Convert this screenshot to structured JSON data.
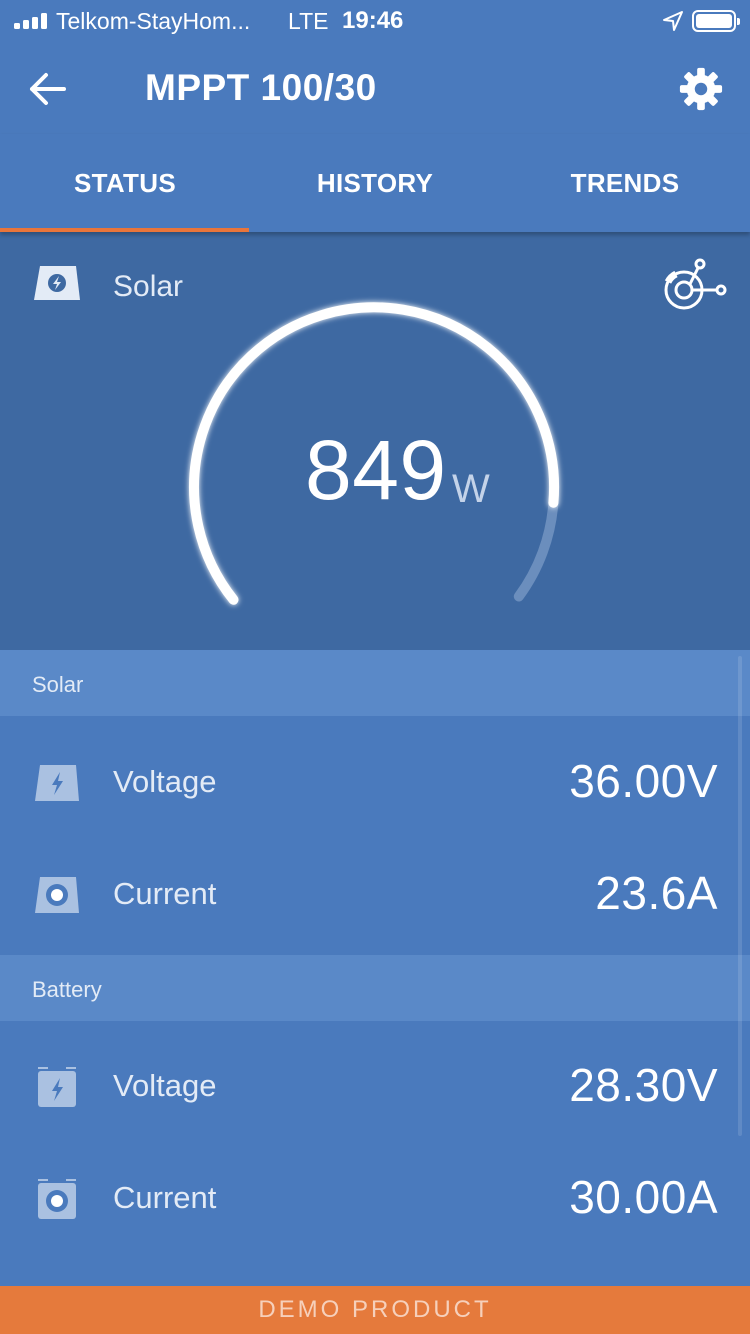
{
  "status_bar": {
    "carrier": "Telkom-StayHom...",
    "network": "LTE",
    "time": "19:46",
    "icons": [
      "signal-icon",
      "location-arrow-icon",
      "battery-icon"
    ]
  },
  "header": {
    "title": "MPPT 100/30",
    "back_icon": "arrow-left-icon",
    "settings_icon": "gear-icon"
  },
  "tabs": [
    {
      "label": "STATUS",
      "active": true
    },
    {
      "label": "HISTORY",
      "active": false
    },
    {
      "label": "TRENDS",
      "active": false
    }
  ],
  "gauge": {
    "label": "Solar",
    "value": "849",
    "unit": "W",
    "icon": "solar-panel-icon",
    "connect_icon": "network-connect-icon"
  },
  "sections": [
    {
      "title": "Solar",
      "rows": [
        {
          "label": "Voltage",
          "value": "36.00V",
          "icon": "voltage-icon"
        },
        {
          "label": "Current",
          "value": "23.6A",
          "icon": "current-icon"
        }
      ]
    },
    {
      "title": "Battery",
      "rows": [
        {
          "label": "Voltage",
          "value": "28.30V",
          "icon": "battery-voltage-icon"
        },
        {
          "label": "Current",
          "value": "30.00A",
          "icon": "battery-current-icon"
        }
      ]
    }
  ],
  "banner": "DEMO PRODUCT",
  "colors": {
    "primary": "#4a7abd",
    "gauge_bg": "#3e69a2",
    "section_header": "#5a89c8",
    "accent": "#e9753b",
    "banner": "#e57a3c"
  }
}
